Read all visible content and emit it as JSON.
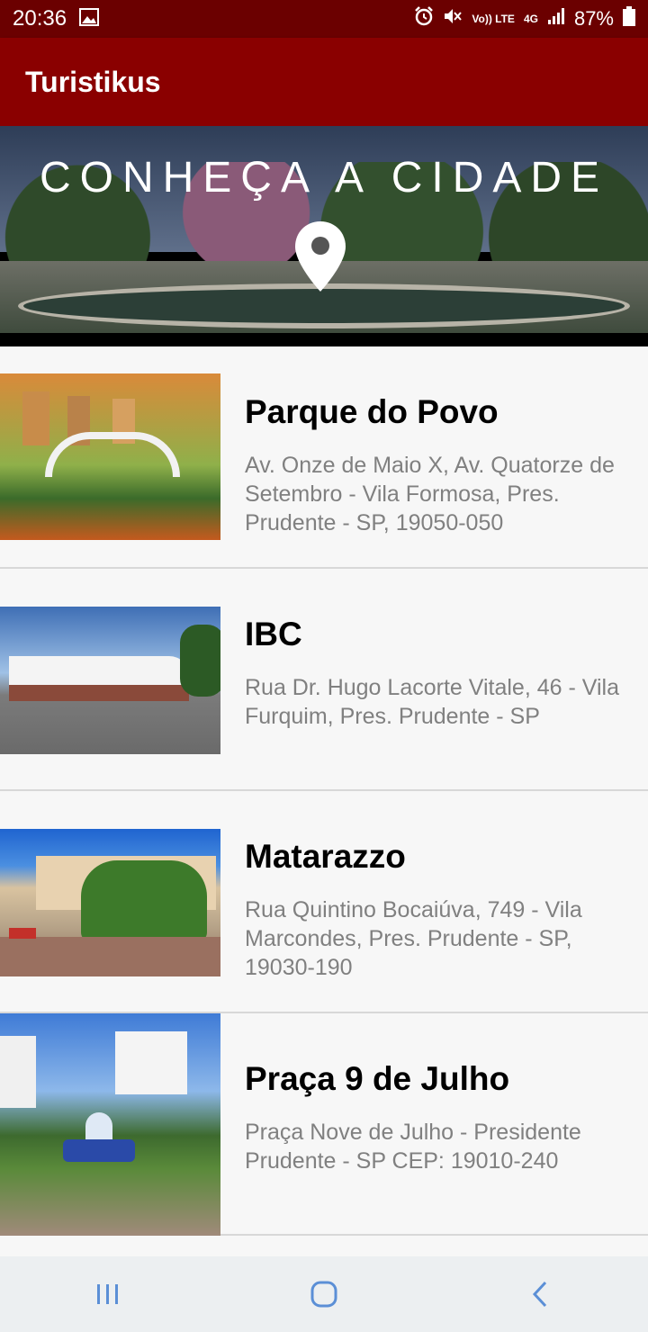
{
  "status": {
    "time": "20:36",
    "battery": "87%",
    "vo_lte": "Vo)) LTE",
    "network": "4G"
  },
  "app": {
    "title": "Turistikus"
  },
  "banner": {
    "title": "CONHEÇA A CIDADE",
    "icon": "map-pin-icon"
  },
  "places": [
    {
      "name": "Parque do Povo",
      "address": "Av. Onze de Maio X, Av. Quatorze de Setembro - Vila Formosa, Pres. Prudente - SP, 19050-050"
    },
    {
      "name": "IBC",
      "address": "Rua Dr. Hugo Lacorte Vitale, 46 - Vila Furquim, Pres. Prudente - SP"
    },
    {
      "name": "Matarazzo",
      "address": "Rua Quintino Bocaiúva, 749 - Vila Marcondes, Pres. Prudente - SP, 19030-190"
    },
    {
      "name": "Praça 9 de Julho",
      "address": "Praça Nove de Julho - Presidente Prudente - SP CEP: 19010-240"
    }
  ],
  "nav": {
    "recents": "recents-icon",
    "home": "home-icon",
    "back": "back-icon"
  },
  "colors": {
    "status_bar": "#6b0000",
    "app_bar": "#8a0000",
    "address_text": "#808080"
  }
}
